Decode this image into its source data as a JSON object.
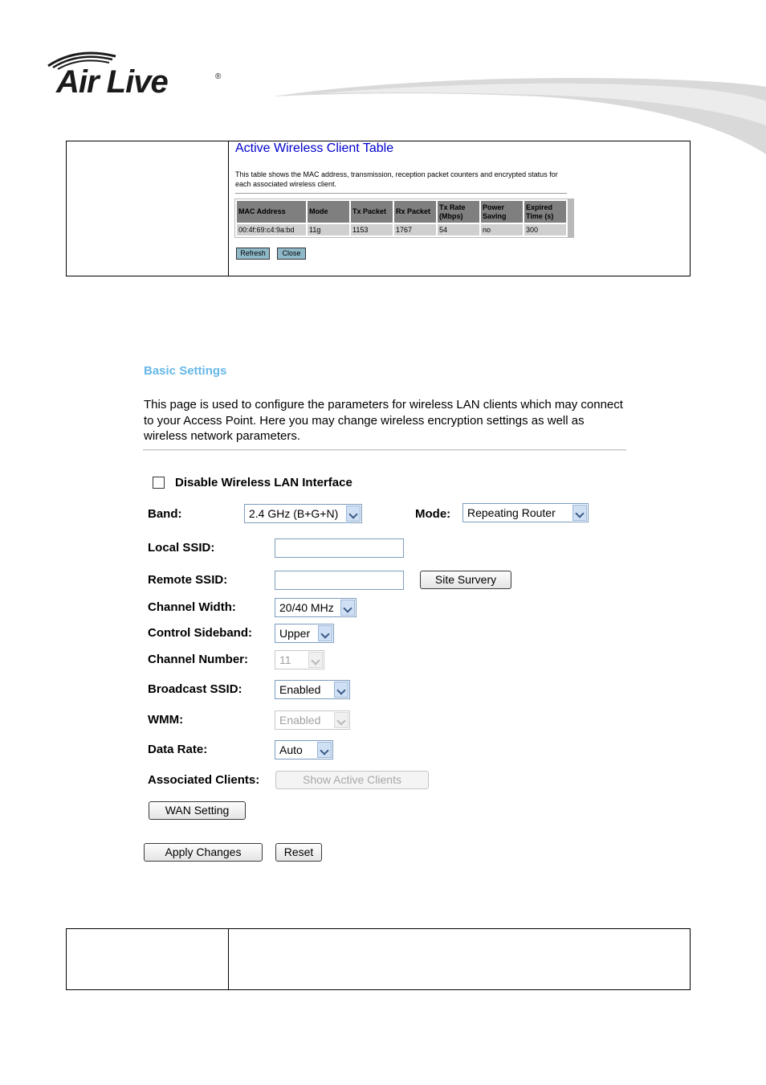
{
  "header": {
    "logo_text": "Air Live",
    "logo_mark": "®"
  },
  "client_table": {
    "title": "Active Wireless Client Table",
    "description": "This table shows the MAC address, transmission, reception packet counters and encrypted status for each associated wireless client.",
    "columns": [
      "MAC Address",
      "Mode",
      "Tx Packet",
      "Rx Packet",
      "Tx Rate (Mbps)",
      "Power Saving",
      "Expired Time (s)"
    ],
    "rows": [
      [
        "00:4f:69:c4:9a:bd",
        "11g",
        "1153",
        "1767",
        "54",
        "no",
        "300"
      ]
    ],
    "refresh_label": "Refresh",
    "close_label": "Close"
  },
  "basic_settings": {
    "title": "Basic Settings",
    "description": "This page is used to configure the parameters for wireless LAN clients which may connect to your Access Point. Here you may change wireless encryption settings as well as wireless network parameters.",
    "disable_label": "Disable Wireless LAN Interface",
    "disable_checked": false,
    "band_label": "Band:",
    "band_value": "2.4 GHz (B+G+N)",
    "mode_label": "Mode:",
    "mode_value": "Repeating Router",
    "local_ssid_label": "Local SSID:",
    "local_ssid_value": "",
    "remote_ssid_label": "Remote SSID:",
    "remote_ssid_value": "",
    "site_survey_label": "Site Survery",
    "channel_width_label": "Channel Width:",
    "channel_width_value": "20/40 MHz",
    "control_sideband_label": "Control Sideband:",
    "control_sideband_value": "Upper",
    "channel_number_label": "Channel Number:",
    "channel_number_value": "11",
    "broadcast_ssid_label": "Broadcast SSID:",
    "broadcast_ssid_value": "Enabled",
    "wmm_label": "WMM:",
    "wmm_value": "Enabled",
    "data_rate_label": "Data Rate:",
    "data_rate_value": "Auto",
    "associated_clients_label": "Associated Clients:",
    "show_clients_label": "Show Active Clients",
    "wan_setting_label": "WAN Setting",
    "apply_label": "Apply Changes",
    "reset_label": "Reset"
  }
}
